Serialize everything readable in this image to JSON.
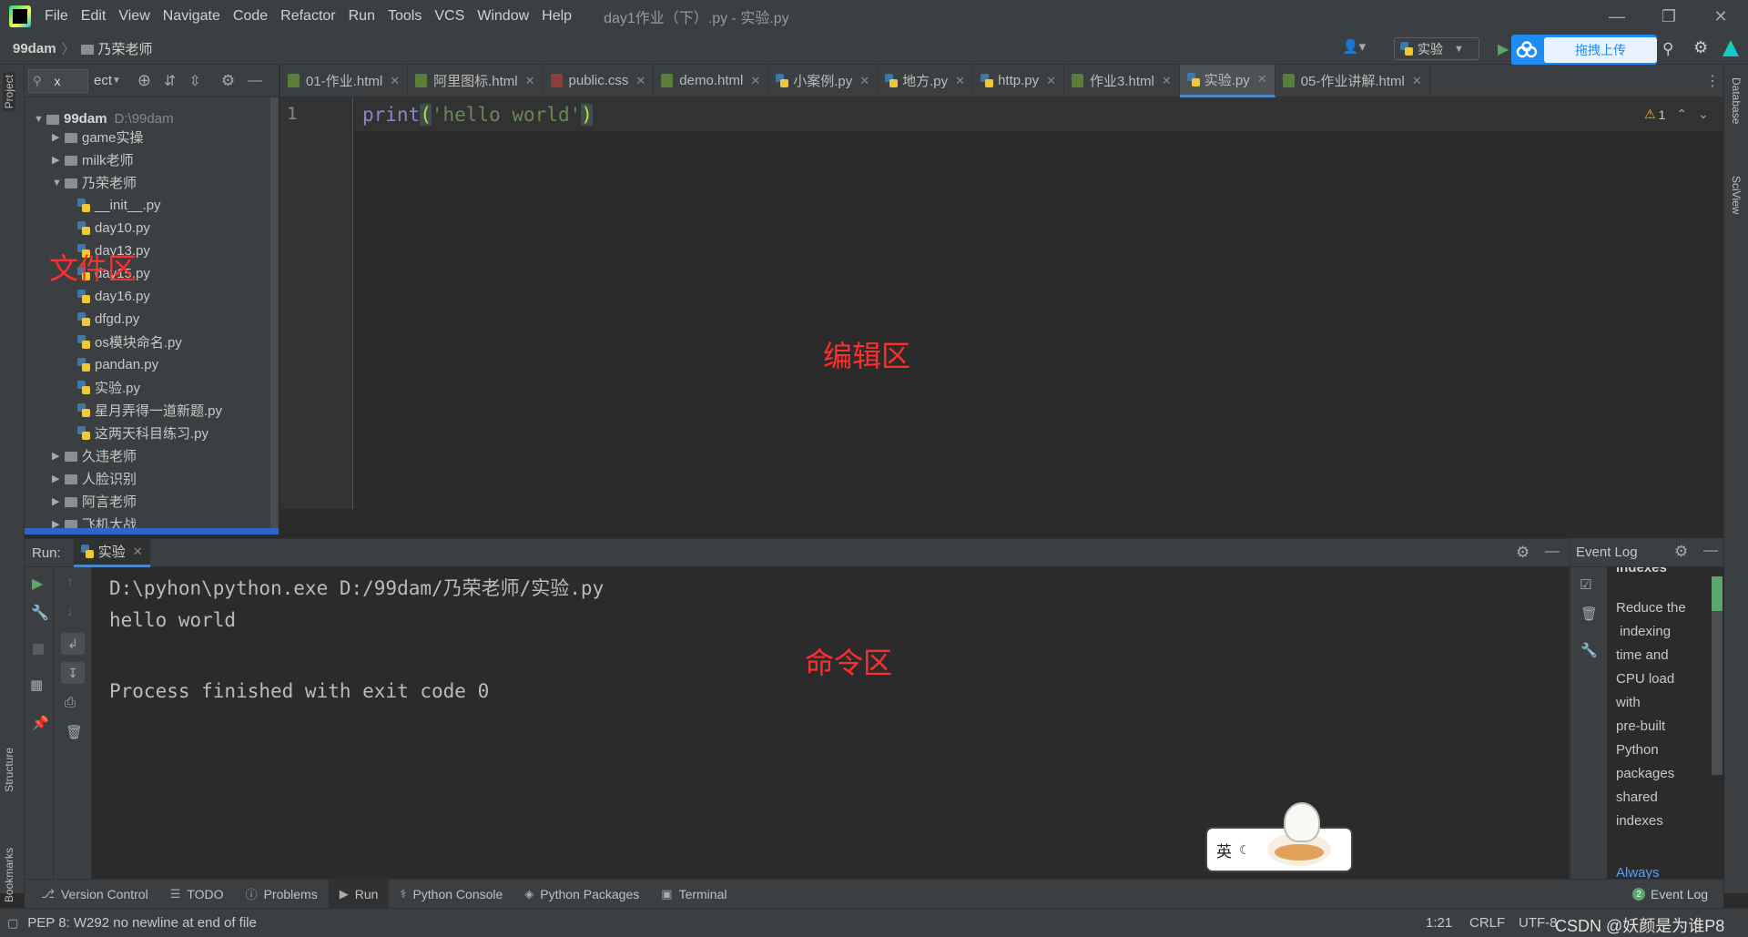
{
  "menubar": {
    "items": [
      "File",
      "Edit",
      "View",
      "Navigate",
      "Code",
      "Refactor",
      "Run",
      "Tools",
      "VCS",
      "Window",
      "Help"
    ],
    "window_title": "day1作业（下）.py - 实验.py"
  },
  "navbar": {
    "project": "99dam",
    "folder": "乃荣老师",
    "run_config": "实验",
    "upload_button": "拖拽上传"
  },
  "project_panel": {
    "search_text": "x",
    "view_label": "ect",
    "root": {
      "name": "99dam",
      "path": "D:\\99dam"
    },
    "tree": [
      {
        "label": "game实操",
        "type": "folder",
        "level": 1,
        "expanded": false
      },
      {
        "label": "milk老师",
        "type": "folder",
        "level": 1,
        "expanded": false
      },
      {
        "label": "乃荣老师",
        "type": "folder",
        "level": 1,
        "expanded": true
      },
      {
        "label": "__init__.py",
        "type": "py",
        "level": 2
      },
      {
        "label": "day10.py",
        "type": "py",
        "level": 2
      },
      {
        "label": "day13.py",
        "type": "py",
        "level": 2
      },
      {
        "label": "day15.py",
        "type": "py",
        "level": 2
      },
      {
        "label": "day16.py",
        "type": "py",
        "level": 2
      },
      {
        "label": "dfgd.py",
        "type": "py",
        "level": 2
      },
      {
        "label": "os模块命名.py",
        "type": "py",
        "level": 2
      },
      {
        "label": "pandan.py",
        "type": "py",
        "level": 2
      },
      {
        "label": "实验.py",
        "type": "py",
        "level": 2
      },
      {
        "label": "星月弄得一道新题.py",
        "type": "py",
        "level": 2
      },
      {
        "label": "这两天科目练习.py",
        "type": "py",
        "level": 2
      },
      {
        "label": "久违老师",
        "type": "folder",
        "level": 1,
        "expanded": false
      },
      {
        "label": "人脸识别",
        "type": "folder",
        "level": 1,
        "expanded": false
      },
      {
        "label": "阿言老师",
        "type": "folder",
        "level": 1,
        "expanded": false
      },
      {
        "label": "飞机大战",
        "type": "folder",
        "level": 1,
        "expanded": false
      }
    ]
  },
  "left_strip": {
    "project": "Project",
    "structure": "Structure",
    "bookmarks": "Bookmarks"
  },
  "right_strip": {
    "database": "Database",
    "sciview": "SciView"
  },
  "editor_tabs": [
    {
      "label": "01-作业.html",
      "kind": "html",
      "active": false
    },
    {
      "label": "阿里图标.html",
      "kind": "html",
      "active": false
    },
    {
      "label": "public.css",
      "kind": "css",
      "active": false
    },
    {
      "label": "demo.html",
      "kind": "html",
      "active": false
    },
    {
      "label": "小案例.py",
      "kind": "py",
      "active": false
    },
    {
      "label": "地方.py",
      "kind": "py",
      "active": false
    },
    {
      "label": "http.py",
      "kind": "py",
      "active": false
    },
    {
      "label": "作业3.html",
      "kind": "html",
      "active": false
    },
    {
      "label": "实验.py",
      "kind": "py",
      "active": true
    },
    {
      "label": "05-作业讲解.html",
      "kind": "html",
      "active": false
    }
  ],
  "editor": {
    "line_number": "1",
    "code_func": "print",
    "code_open": "(",
    "code_str": "'hello world'",
    "code_close": ")",
    "warnings": "1"
  },
  "annotations": {
    "file_area": "文件区",
    "edit_area": "编辑区",
    "command_area": "命令区"
  },
  "run_panel": {
    "label": "Run:",
    "tab": "实验",
    "console": [
      "D:\\pyhon\\python.exe D:/99dam/乃荣老师/实验.py",
      "hello world",
      "",
      "Process finished with exit code 0"
    ]
  },
  "event_log": {
    "title": "Event Log",
    "top_text": "indexes",
    "lines": [
      "Reduce the",
      " indexing",
      "time and",
      "CPU load",
      "with",
      "pre-built",
      "Python",
      "packages",
      "shared",
      "indexes"
    ],
    "link": "Always"
  },
  "ime": {
    "label": "英"
  },
  "bottom_tabs": [
    {
      "label": "Version Control",
      "icon": "branch-icon"
    },
    {
      "label": "TODO",
      "icon": "list-icon"
    },
    {
      "label": "Problems",
      "icon": "info-icon"
    },
    {
      "label": "Run",
      "icon": "play-icon",
      "active": true
    },
    {
      "label": "Python Console",
      "icon": "python-icon"
    },
    {
      "label": "Python Packages",
      "icon": "layers-icon"
    },
    {
      "label": "Terminal",
      "icon": "terminal-icon"
    }
  ],
  "event_log_tab": {
    "badge": "2",
    "label": "Event Log"
  },
  "status_bar": {
    "message": "PEP 8: W292 no newline at end of file",
    "position": "1:21",
    "line_sep": "CRLF",
    "encoding": "UTF-8",
    "watermark": "CSDN @妖颜是为谁P8"
  },
  "colors": {
    "accent": "#4a88c7",
    "annotation_red": "#ff2e2e",
    "string_green": "#6a8759",
    "keyword": "#8888c6",
    "upload_blue": "#1e8cf0"
  }
}
